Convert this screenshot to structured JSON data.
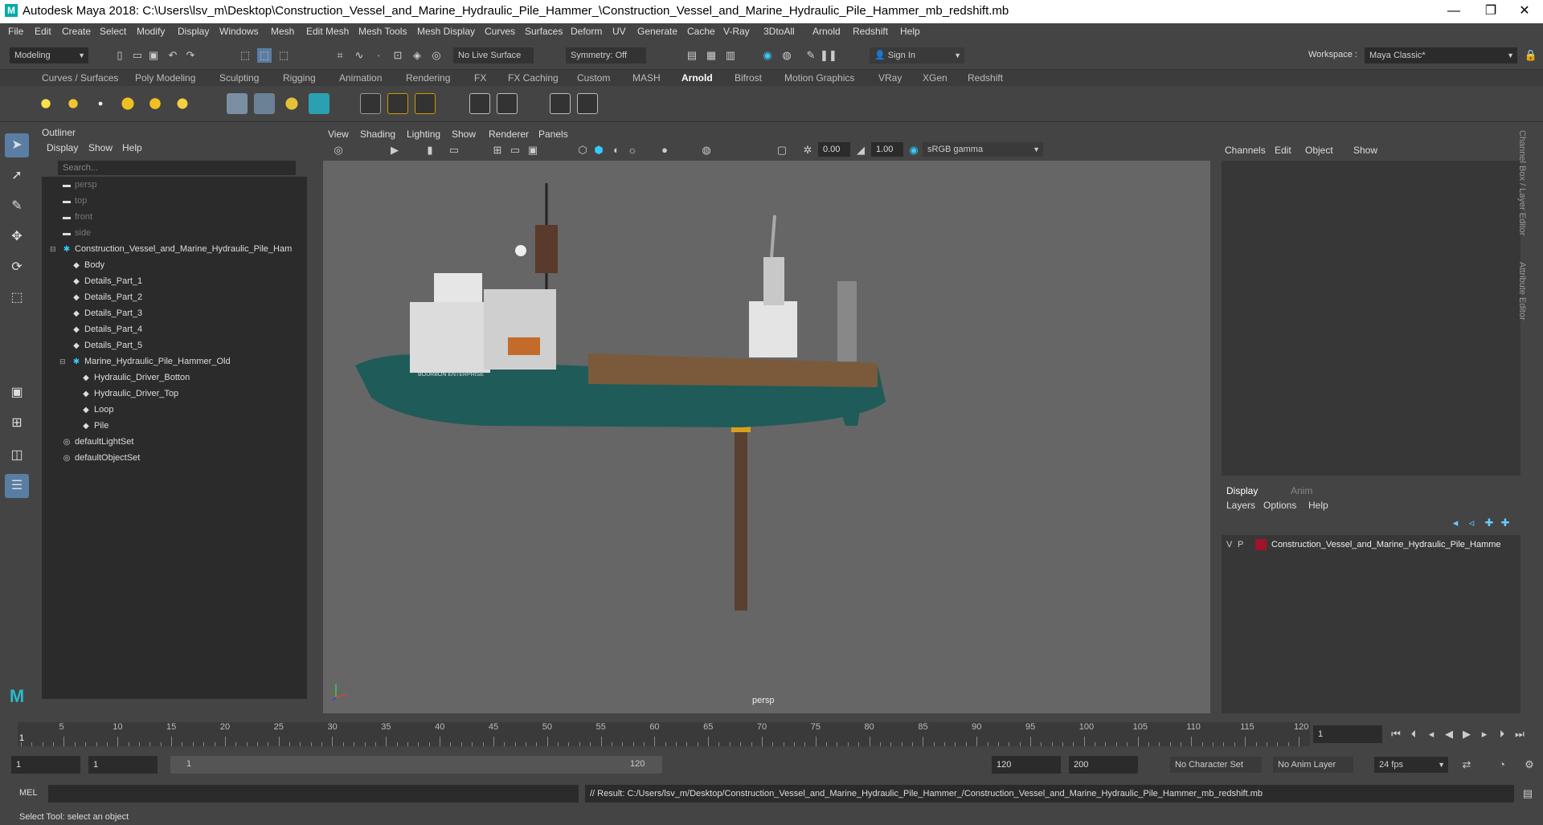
{
  "window": {
    "title": "Autodesk Maya 2018: C:\\Users\\lsv_m\\Desktop\\Construction_Vessel_and_Marine_Hydraulic_Pile_Hammer_\\Construction_Vessel_and_Marine_Hydraulic_Pile_Hammer_mb_redshift.mb",
    "minimize": "—",
    "restore": "❐",
    "close": "✕"
  },
  "menubar": [
    "File",
    "Edit",
    "Create",
    "Select",
    "Modify",
    "Display",
    "Windows",
    "Mesh",
    "Edit Mesh",
    "Mesh Tools",
    "Mesh Display",
    "Curves",
    "Surfaces",
    "Deform",
    "UV",
    "Generate",
    "Cache",
    "V-Ray",
    "3DtoAll",
    "Arnold",
    "Redshift",
    "Help"
  ],
  "statusline": {
    "mode": "Modeling",
    "live_surface": "No Live Surface",
    "symmetry": "Symmetry: Off",
    "sign_in": "Sign In",
    "workspace_label": "Workspace :",
    "workspace_value": "Maya Classic*"
  },
  "shelf_tabs": [
    "Curves / Surfaces",
    "Poly Modeling",
    "Sculpting",
    "Rigging",
    "Animation",
    "Rendering",
    "FX",
    "FX Caching",
    "Custom",
    "MASH",
    "Arnold",
    "Bifrost",
    "Motion Graphics",
    "VRay",
    "XGen",
    "Redshift"
  ],
  "shelf_active": "Arnold",
  "outliner": {
    "title": "Outliner",
    "menu": [
      "Display",
      "Show",
      "Help"
    ],
    "search_placeholder": "Search...",
    "items": [
      {
        "label": "persp",
        "indent": 0,
        "dim": true,
        "icon": "camera-icon"
      },
      {
        "label": "top",
        "indent": 0,
        "dim": true,
        "icon": "camera-icon"
      },
      {
        "label": "front",
        "indent": 0,
        "dim": true,
        "icon": "camera-icon"
      },
      {
        "label": "side",
        "indent": 0,
        "dim": true,
        "icon": "camera-icon"
      },
      {
        "label": "Construction_Vessel_and_Marine_Hydraulic_Pile_Ham",
        "indent": 0,
        "dim": false,
        "icon": "group-icon",
        "expanded": true
      },
      {
        "label": "Body",
        "indent": 1,
        "dim": false,
        "icon": "mesh-icon"
      },
      {
        "label": "Details_Part_1",
        "indent": 1,
        "dim": false,
        "icon": "mesh-icon"
      },
      {
        "label": "Details_Part_2",
        "indent": 1,
        "dim": false,
        "icon": "mesh-icon"
      },
      {
        "label": "Details_Part_3",
        "indent": 1,
        "dim": false,
        "icon": "mesh-icon"
      },
      {
        "label": "Details_Part_4",
        "indent": 1,
        "dim": false,
        "icon": "mesh-icon"
      },
      {
        "label": "Details_Part_5",
        "indent": 1,
        "dim": false,
        "icon": "mesh-icon"
      },
      {
        "label": "Marine_Hydraulic_Pile_Hammer_Old",
        "indent": 1,
        "dim": false,
        "icon": "group-icon",
        "expanded": true
      },
      {
        "label": "Hydraulic_Driver_Botton",
        "indent": 2,
        "dim": false,
        "icon": "mesh-icon"
      },
      {
        "label": "Hydraulic_Driver_Top",
        "indent": 2,
        "dim": false,
        "icon": "mesh-icon"
      },
      {
        "label": "Loop",
        "indent": 2,
        "dim": false,
        "icon": "mesh-icon"
      },
      {
        "label": "Pile",
        "indent": 2,
        "dim": false,
        "icon": "mesh-icon"
      },
      {
        "label": "defaultLightSet",
        "indent": 0,
        "dim": false,
        "icon": "set-icon"
      },
      {
        "label": "defaultObjectSet",
        "indent": 0,
        "dim": false,
        "icon": "set-icon"
      }
    ]
  },
  "viewport": {
    "menu": [
      "View",
      "Shading",
      "Lighting",
      "Show",
      "Renderer",
      "Panels"
    ],
    "exposure": "0.00",
    "gamma": "1.00",
    "color_space": "sRGB gamma",
    "camera_label": "persp",
    "vessel_name": "BOURBON ENTERPRISE"
  },
  "channel_box": {
    "menu": [
      "Channels",
      "Edit",
      "Object",
      "Show"
    ],
    "side_tab_1": "Channel Box / Layer Editor",
    "side_tab_2": "Attribute Editor"
  },
  "layer_editor": {
    "tabs": [
      "Display",
      "Anim"
    ],
    "active_tab": "Display",
    "menu": [
      "Layers",
      "Options",
      "Help"
    ],
    "layer": {
      "v": "V",
      "p": "P",
      "name": "Construction_Vessel_and_Marine_Hydraulic_Pile_Hamme",
      "color": "#a0132b"
    }
  },
  "timeline": {
    "ticks": [
      "5",
      "10",
      "15",
      "20",
      "25",
      "30",
      "35",
      "40",
      "45",
      "50",
      "55",
      "60",
      "65",
      "70",
      "75",
      "80",
      "85",
      "90",
      "95",
      "100",
      "105",
      "110",
      "115",
      "120"
    ],
    "current_marker": "1",
    "current_frame": "1"
  },
  "range": {
    "start": "1",
    "anim_start": "1",
    "slider_start": "1",
    "slider_end": "120",
    "anim_end": "120",
    "end": "200",
    "character_set": "No Character Set",
    "anim_layer": "No Anim Layer",
    "fps": "24 fps"
  },
  "command_line": {
    "label": "MEL",
    "result": "// Result: C:/Users/lsv_m/Desktop/Construction_Vessel_and_Marine_Hydraulic_Pile_Hammer_/Construction_Vessel_and_Marine_Hydraulic_Pile_Hammer_mb_redshift.mb"
  },
  "help_line": "Select Tool: select an object",
  "colors": {
    "hull": "#1f5b58",
    "superstructure": "#dcdcdc",
    "deck": "#7a5a3a",
    "pile": "#5a4030",
    "hammer": "#d8a020"
  }
}
